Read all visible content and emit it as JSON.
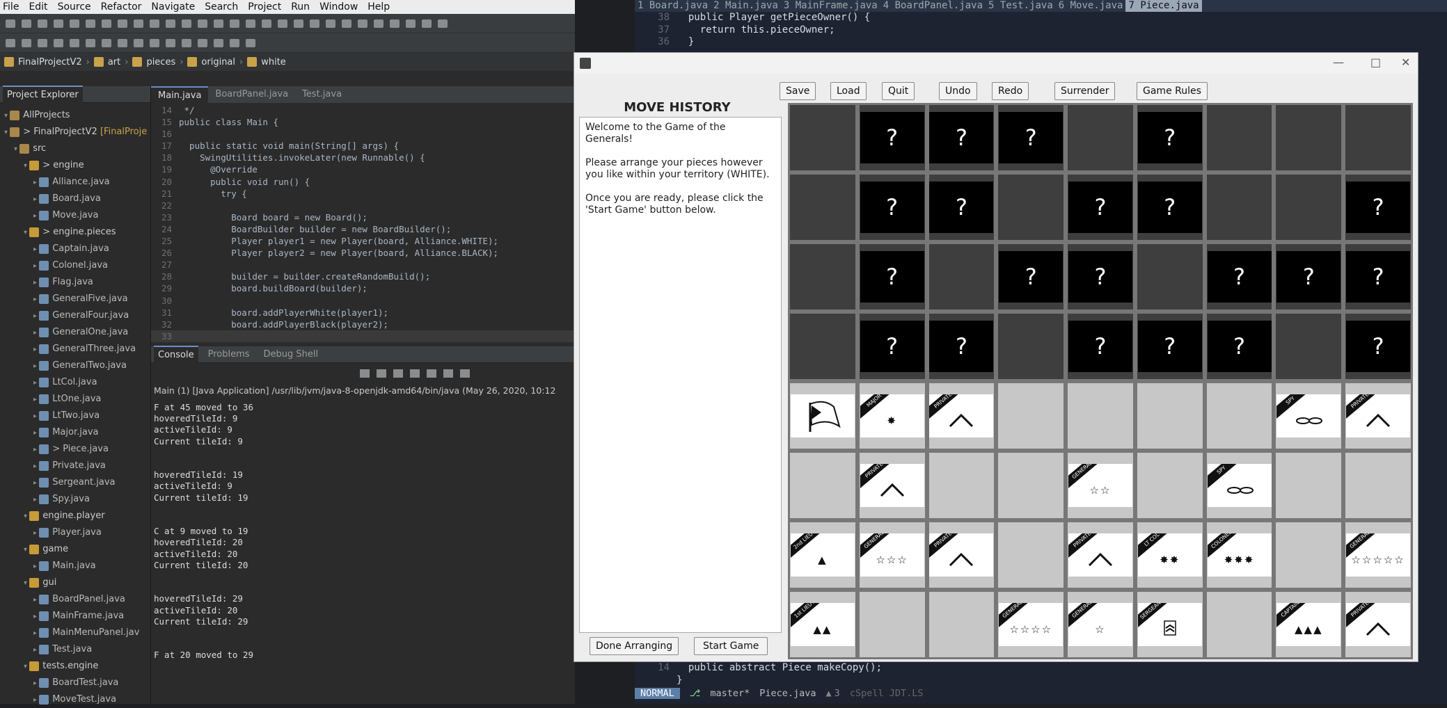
{
  "eclipse": {
    "menu": [
      "File",
      "Edit",
      "Source",
      "Refactor",
      "Navigate",
      "Search",
      "Project",
      "Run",
      "Window",
      "Help"
    ],
    "breadcrumb": [
      "FinalProjectV2",
      "art",
      "pieces",
      "original",
      "white"
    ],
    "project_explorer": {
      "title": "Project Explorer",
      "items": [
        {
          "label": "AllProjects",
          "depth": 0,
          "type": "folder"
        },
        {
          "label": "> FinalProjectV2",
          "suffix": " [FinalProje",
          "depth": 0,
          "type": "project"
        },
        {
          "label": "src",
          "depth": 1,
          "type": "folder"
        },
        {
          "label": "> engine",
          "depth": 2,
          "type": "package"
        },
        {
          "label": "Alliance.java",
          "depth": 3,
          "type": "file"
        },
        {
          "label": "Board.java",
          "depth": 3,
          "type": "file"
        },
        {
          "label": "Move.java",
          "depth": 3,
          "type": "file"
        },
        {
          "label": "> engine.pieces",
          "depth": 2,
          "type": "package"
        },
        {
          "label": "Captain.java",
          "depth": 3,
          "type": "file"
        },
        {
          "label": "Colonel.java",
          "depth": 3,
          "type": "file"
        },
        {
          "label": "Flag.java",
          "depth": 3,
          "type": "file"
        },
        {
          "label": "GeneralFive.java",
          "depth": 3,
          "type": "file"
        },
        {
          "label": "GeneralFour.java",
          "depth": 3,
          "type": "file"
        },
        {
          "label": "GeneralOne.java",
          "depth": 3,
          "type": "file"
        },
        {
          "label": "GeneralThree.java",
          "depth": 3,
          "type": "file"
        },
        {
          "label": "GeneralTwo.java",
          "depth": 3,
          "type": "file"
        },
        {
          "label": "LtCol.java",
          "depth": 3,
          "type": "file"
        },
        {
          "label": "LtOne.java",
          "depth": 3,
          "type": "file"
        },
        {
          "label": "LtTwo.java",
          "depth": 3,
          "type": "file"
        },
        {
          "label": "Major.java",
          "depth": 3,
          "type": "file"
        },
        {
          "label": "> Piece.java",
          "depth": 3,
          "type": "file"
        },
        {
          "label": "Private.java",
          "depth": 3,
          "type": "file"
        },
        {
          "label": "Sergeant.java",
          "depth": 3,
          "type": "file"
        },
        {
          "label": "Spy.java",
          "depth": 3,
          "type": "file"
        },
        {
          "label": "engine.player",
          "depth": 2,
          "type": "package"
        },
        {
          "label": "Player.java",
          "depth": 3,
          "type": "file"
        },
        {
          "label": "game",
          "depth": 2,
          "type": "package"
        },
        {
          "label": "Main.java",
          "depth": 3,
          "type": "file"
        },
        {
          "label": "gui",
          "depth": 2,
          "type": "package"
        },
        {
          "label": "BoardPanel.java",
          "depth": 3,
          "type": "file"
        },
        {
          "label": "MainFrame.java",
          "depth": 3,
          "type": "file"
        },
        {
          "label": "MainMenuPanel.jav",
          "depth": 3,
          "type": "file"
        },
        {
          "label": "Test.java",
          "depth": 3,
          "type": "file"
        },
        {
          "label": "tests.engine",
          "depth": 2,
          "type": "package"
        },
        {
          "label": "BoardTest.java",
          "depth": 3,
          "type": "file"
        },
        {
          "label": "MoveTest.java",
          "depth": 3,
          "type": "file"
        }
      ]
    },
    "editor_tabs": [
      "Main.java",
      "BoardPanel.java",
      "Test.java"
    ],
    "code_lines": [
      {
        "n": "14",
        "t": " */"
      },
      {
        "n": "15",
        "t": "public class Main {"
      },
      {
        "n": "16",
        "t": ""
      },
      {
        "n": "17",
        "t": "  public static void main(String[] args) {"
      },
      {
        "n": "18",
        "t": "    SwingUtilities.invokeLater(new Runnable() {"
      },
      {
        "n": "19",
        "t": "      @Override"
      },
      {
        "n": "20",
        "t": "      public void run() {"
      },
      {
        "n": "21",
        "t": "        try {"
      },
      {
        "n": "22",
        "t": ""
      },
      {
        "n": "23",
        "t": "          Board board = new Board();"
      },
      {
        "n": "24",
        "t": "          BoardBuilder builder = new BoardBuilder();"
      },
      {
        "n": "25",
        "t": "          Player player1 = new Player(board, Alliance.WHITE);"
      },
      {
        "n": "26",
        "t": "          Player player2 = new Player(board, Alliance.BLACK);"
      },
      {
        "n": "27",
        "t": ""
      },
      {
        "n": "28",
        "t": "          builder = builder.createRandomBuild();"
      },
      {
        "n": "29",
        "t": "          board.buildBoard(builder);"
      },
      {
        "n": "30",
        "t": ""
      },
      {
        "n": "31",
        "t": "          board.addPlayerWhite(player1);"
      },
      {
        "n": "32",
        "t": "          board.addPlayerBlack(player2);"
      },
      {
        "n": "33",
        "t": ""
      }
    ],
    "console_tabs": [
      "Console",
      "Problems",
      "Debug Shell"
    ],
    "console_path": "Main (1) [Java Application] /usr/lib/jvm/java-8-openjdk-amd64/bin/java  (May 26, 2020, 10:12",
    "console_output": "F at 45 moved to 36\nhoveredTileId: 9\nactiveTileId: 9\nCurrent tileId: 9\n\n\nhoveredTileId: 19\nactiveTileId: 9\nCurrent tileId: 19\n\n\nC at 9 moved to 19\nhoveredTileId: 20\nactiveTileId: 20\nCurrent tileId: 20\n\n\nhoveredTileId: 29\nactiveTileId: 20\nCurrent tileId: 29\n\n\nF at 20 moved to 29"
  },
  "vim": {
    "tabs": [
      "1 Board.java",
      "2 Main.java",
      "3 MainFrame.java",
      "4 BoardPanel.java",
      "5 Test.java",
      "6 Move.java",
      "7 Piece.java"
    ],
    "active_tab": 6,
    "top_lines": [
      {
        "n": "38",
        "t": "  public Player getPieceOwner() {"
      },
      {
        "n": "37",
        "t": "    return this.pieceOwner;"
      },
      {
        "n": "36",
        "t": "  }"
      }
    ],
    "bottom_lines": [
      {
        "n": "14",
        "t": "  public abstract Piece makeCopy();"
      },
      {
        "n": "",
        "t": "}"
      }
    ],
    "status": {
      "mode": "NORMAL",
      "branch": "master*",
      "file": "Piece.java",
      "warnings": "3",
      "extra": "cSpell JDT.LS"
    }
  },
  "game": {
    "title_buttons": [
      "—",
      "□",
      "✕"
    ],
    "buttons": {
      "save": "Save",
      "load": "Load",
      "quit": "Quit",
      "undo": "Undo",
      "redo": "Redo",
      "surrender": "Surrender",
      "rules": "Game Rules",
      "done": "Done Arranging",
      "start": "Start Game"
    },
    "history_title": "MOVE HISTORY",
    "history_text": [
      "Welcome to the Game of the Generals!",
      "Please arrange your pieces however you like within your territory (WHITE).",
      "Once you are ready, please click the 'Start Game' button below."
    ],
    "hidden_glyph": "?",
    "board": [
      [
        "",
        "?",
        "?",
        "?",
        "",
        "?",
        "",
        "",
        ""
      ],
      [
        "",
        "?",
        "?",
        "",
        "?",
        "?",
        "",
        "",
        "?"
      ],
      [
        "",
        "?",
        "",
        "?",
        "?",
        "",
        "?",
        "?",
        "?"
      ],
      [
        "",
        "?",
        "?",
        "",
        "?",
        "?",
        "?",
        "",
        "?"
      ],
      [
        "FLAG",
        "MAJOR",
        "PRIVATE",
        "",
        "",
        "",
        "",
        "SPY",
        "PRIVATE"
      ],
      [
        "",
        "PRIVATE",
        "",
        "",
        "GENERAL2",
        "",
        "SPY",
        "",
        ""
      ],
      [
        "2nd LIEUT",
        "GENERAL3",
        "PRIVATE",
        "",
        "PRIVATE",
        "LT COL",
        "COLONEL",
        "",
        "GENERAL5"
      ],
      [
        "1st LIEUT",
        "",
        "",
        "GENERAL4",
        "GENERAL1",
        "SERGEANT",
        "",
        "CAPTAIN",
        "PRIVATE"
      ]
    ],
    "piece_labels": {
      "FLAG": "",
      "MAJOR": "MAJOR",
      "PRIVATE": "PRIVATE",
      "SPY": "SPY",
      "GENERAL1": "GENERAL",
      "GENERAL2": "GENERAL",
      "GENERAL3": "GENERAL",
      "GENERAL4": "GENERAL",
      "GENERAL5": "GENERAL",
      "2nd LIEUT": "2nd LIEUT",
      "1st LIEUT": "1st LIEUT",
      "LT COL": "LT COL",
      "COLONEL": "COLONEL",
      "SERGEANT": "SERGEANT",
      "CAPTAIN": "CAPTAIN"
    },
    "piece_symbols": {
      "MAJOR": "✸",
      "PRIVATE": "^",
      "SPY": "eyes",
      "FLAG": "flag",
      "GENERAL1": "☆",
      "GENERAL2": "☆☆",
      "GENERAL3": "☆☆☆",
      "GENERAL4": "☆☆☆☆",
      "GENERAL5": "☆☆☆☆☆",
      "2nd LIEUT": "▲",
      "1st LIEUT": "▲▲",
      "CAPTAIN": "▲▲▲",
      "LT COL": "✸✸",
      "COLONEL": "✸✸✸",
      "SERGEANT": "chevrons"
    }
  }
}
